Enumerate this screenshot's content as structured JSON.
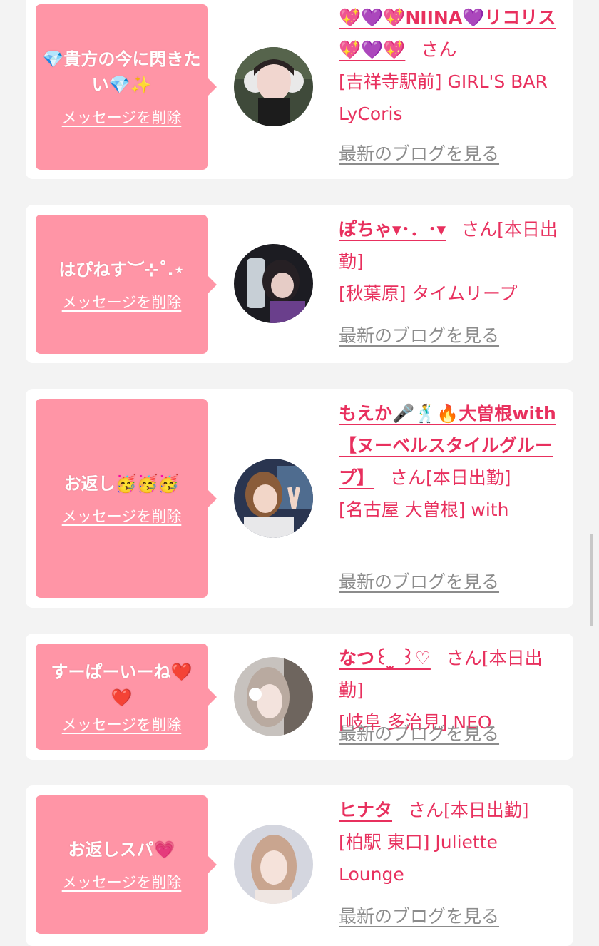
{
  "common": {
    "delete_label": "メッセージを削除",
    "blog_label": "最新のブログを見る",
    "accent_color": "#e8305e",
    "bubble_color": "#ff95a6"
  },
  "messages": [
    {
      "message": "💎貴方の今に閃きたい💎✨",
      "name": "💖💜💖NIINA💜リコリス💖💜💖",
      "suffix": "さん",
      "shop": "[吉祥寺駅前] GIRL'S BAR LyCoris"
    },
    {
      "message": "はぴねす︶⊹˚.⋆",
      "name": "ぽちゃ▾･．･▾",
      "suffix": "さん[本日出勤]",
      "shop": "[秋葉原] タイムリープ"
    },
    {
      "message": "お返し🥳🥳🥳",
      "name": "もえか🎤🕺🔥大曽根with【ヌーベルスタイルグループ】",
      "suffix": "さん[本日出勤]",
      "shop": "[名古屋 大曽根] with"
    },
    {
      "message": "すーぱーいーね❤️❤️",
      "name": "なつ꒰ ̫ ꒱♡",
      "suffix": "さん[本日出勤]",
      "shop": "[岐阜 多治見] NEO"
    },
    {
      "message": "お返しスパ💗",
      "name": "ヒナタ",
      "suffix": "さん[本日出勤]",
      "shop": "[柏駅 東口] Juliette Lounge"
    }
  ]
}
